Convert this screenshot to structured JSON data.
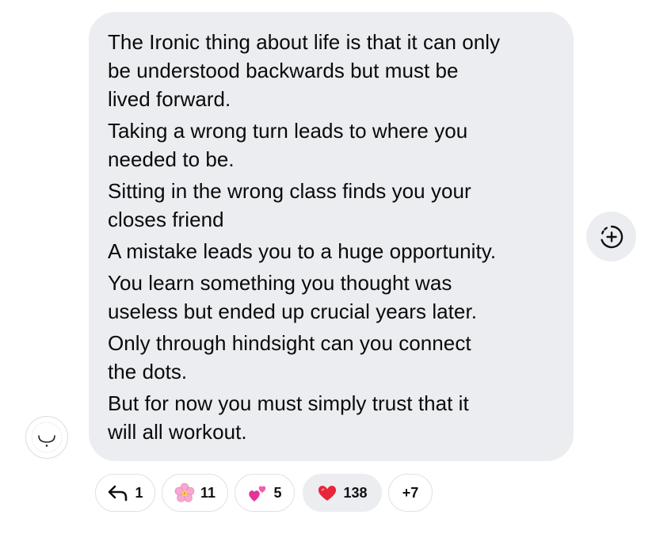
{
  "message": {
    "lines": [
      "The Ironic thing about life is that it can only",
      "be understood backwards but must be",
      "lived forward.",
      "Taking a wrong turn leads to where you",
      "needed to be.",
      "Sitting in the wrong class finds you your",
      "closes friend",
      "A mistake leads you to a huge opportunity.",
      "You learn something you thought was",
      "useless but ended up crucial years later.",
      "Only through hindsight can you connect",
      "the dots.",
      "But for now you must simply trust that it",
      "will all workout."
    ]
  },
  "sender": {
    "avatar_icon": "arabic-letter-ba-logo"
  },
  "add_reaction": {
    "icon": "add-reaction-icon"
  },
  "reactions": [
    {
      "type": "replies",
      "icon": "reply-arrow-icon",
      "count": "1"
    },
    {
      "type": "emoji",
      "icon": "cherry-blossom-emoji",
      "count": "11"
    },
    {
      "type": "emoji",
      "icon": "two-hearts-emoji",
      "count": "5"
    },
    {
      "type": "emoji",
      "icon": "red-heart-emoji",
      "count": "138",
      "active": true
    },
    {
      "type": "more",
      "count": "+7"
    }
  ],
  "colors": {
    "bubble_bg": "#ecedf0",
    "pill_border": "#dfe1e5",
    "heart_red": "#e8253b",
    "blossom_pink": "#f7a8cf"
  }
}
